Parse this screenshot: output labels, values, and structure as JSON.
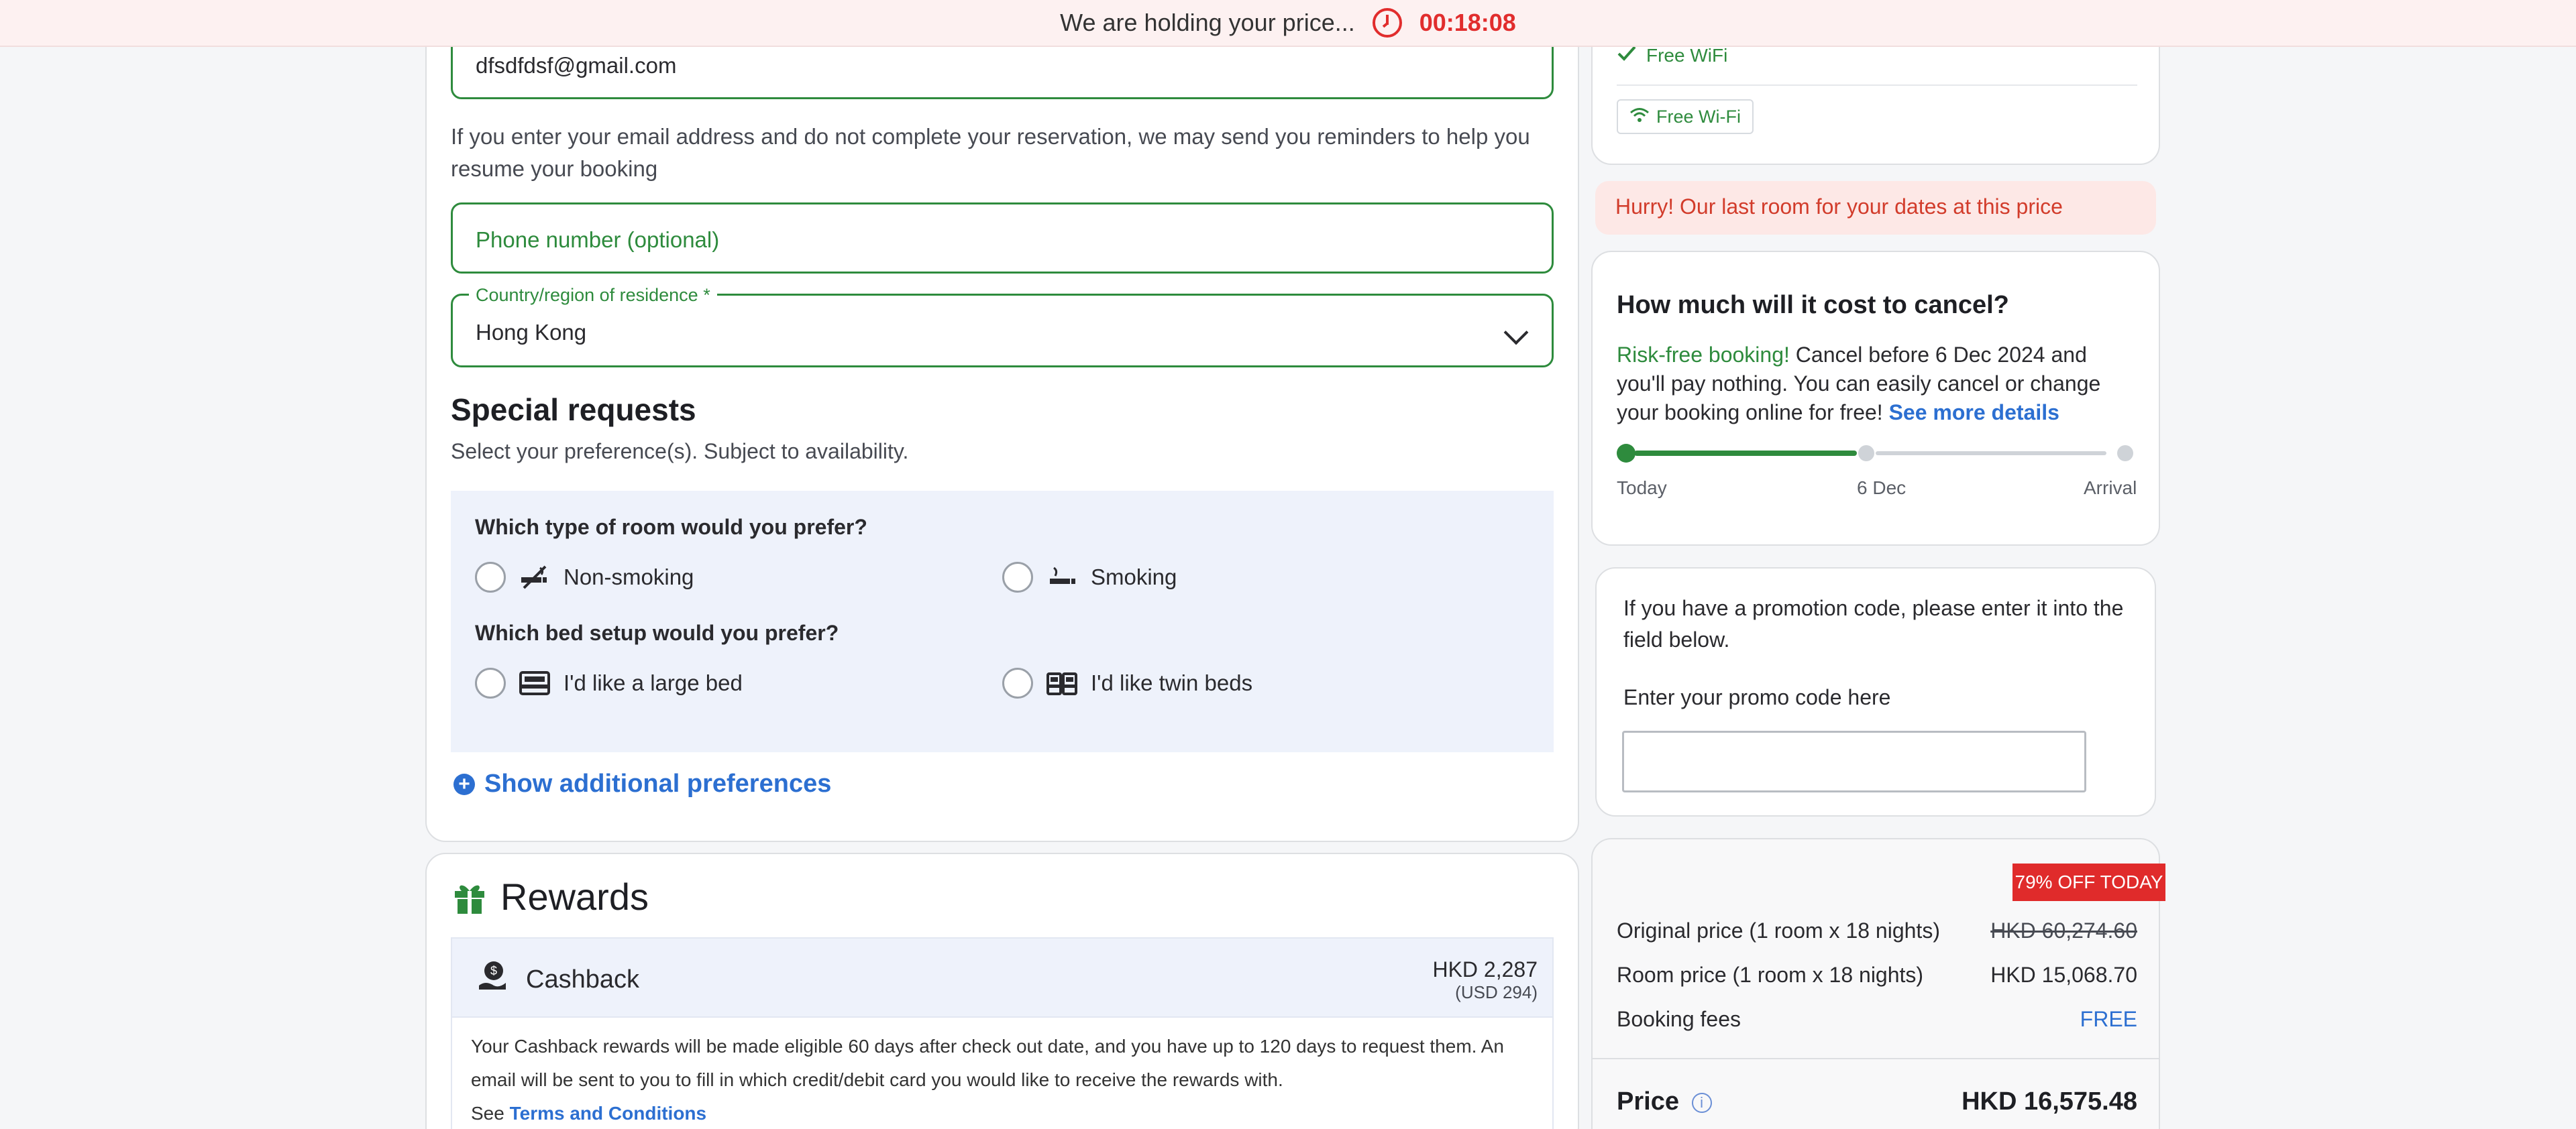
{
  "banner": {
    "message": "We are holding your price...",
    "timer": "00:18:08"
  },
  "form": {
    "email_value": "dfsdfdsf@gmail.com",
    "email_note": "If you enter your email address and do not complete your reservation, we may send you reminders to help you resume your booking",
    "phone_placeholder": "Phone number (optional)",
    "country_label": "Country/region of residence *",
    "country_value": "Hong Kong"
  },
  "special_requests": {
    "title": "Special requests",
    "subtitle": "Select your preference(s). Subject to availability.",
    "room_question": "Which type of room would you prefer?",
    "room_options": [
      "Non-smoking",
      "Smoking"
    ],
    "bed_question": "Which bed setup would you prefer?",
    "bed_options": [
      "I'd like a large bed",
      "I'd like twin beds"
    ],
    "show_more": "Show additional preferences"
  },
  "rewards": {
    "title": "Rewards",
    "cashback_label": "Cashback",
    "cashback_amount": "HKD 2,287",
    "cashback_usd": "(USD 294)",
    "cashback_text": "Your Cashback rewards will be made eligible 60 days after check out date, and you have up to 120 days to request them. An email will be sent to you to fill in which credit/debit card you would like to receive the rewards with.",
    "see_prefix": "See",
    "terms_link": "Terms and Conditions"
  },
  "amenities": {
    "wifi_check": "Free WiFi",
    "wifi_badge": "Free Wi-Fi"
  },
  "hurry": "Hurry! Our last room for your dates at this price",
  "cancellation": {
    "title": "How much will it cost to cancel?",
    "risk_free": "Risk-free booking!",
    "text": "Cancel before 6 Dec 2024 and you'll pay nothing. You can easily cancel or change your booking online for free!",
    "see_more": "See more details",
    "timeline": [
      "Today",
      "6 Dec",
      "Arrival"
    ],
    "colors": {
      "active": "#2e8b3d",
      "inactive": "#cfd3d8"
    }
  },
  "promo": {
    "text": "If you have a promotion code, please enter it into the field below.",
    "label": "Enter your promo code here",
    "value": ""
  },
  "price": {
    "badge": "79% OFF TODAY",
    "original_label": "Original price (1 room x 18 nights)",
    "original_value": "HKD 60,274.60",
    "room_label": "Room price (1 room x 18 nights)",
    "room_value": "HKD 15,068.70",
    "fees_label": "Booking fees",
    "fees_value": "FREE",
    "total_label": "Price",
    "total_value": "HKD 16,575.48"
  }
}
